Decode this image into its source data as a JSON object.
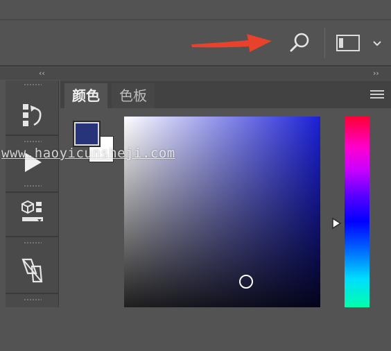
{
  "options_bar": {
    "search_icon": "search-icon",
    "workspace_icon": "workspace-layout-icon",
    "workspace_caret_icon": "chevron-down-icon"
  },
  "annotation": {
    "color": "#e8412c",
    "icon": "red-pointer-arrow"
  },
  "dock": {
    "collapse_left": "‹‹",
    "collapse_right": "››"
  },
  "tools": [
    {
      "name": "history",
      "icon": "history-icon"
    },
    {
      "name": "actions",
      "icon": "play-icon"
    },
    {
      "name": "3d",
      "icon": "cube-3d-icon"
    },
    {
      "name": "transform",
      "icon": "transform-icon"
    }
  ],
  "color_panel": {
    "tabs": [
      {
        "label": "颜色",
        "active": true
      },
      {
        "label": "色板",
        "active": false
      }
    ],
    "foreground_color": "#28347a",
    "background_color": "#ffffff",
    "picker_hue_color": "#1a1fd6"
  },
  "watermark": {
    "text": "www.haoyicunsheji.com"
  }
}
